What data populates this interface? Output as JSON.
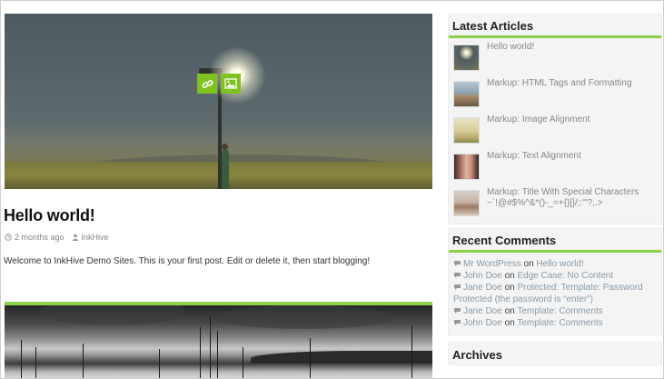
{
  "post": {
    "title": "Hello world!",
    "date": "2 months ago",
    "author": "InkHive",
    "excerpt": "Welcome to InkHive Demo Sites. This is your first post. Edit or delete it, then start blogging!"
  },
  "icons": {
    "link": "link-icon",
    "image": "image-icon",
    "clock": "clock-icon",
    "user": "user-icon",
    "comment": "comment-icon"
  },
  "colors": {
    "accent": "#8bd24a",
    "hover_button": "#7dc21e"
  },
  "sidebar": {
    "latest_title": "Latest Articles",
    "articles": [
      {
        "title": "Hello world!"
      },
      {
        "title": "Markup: HTML Tags and Formatting"
      },
      {
        "title": "Markup: Image Alignment"
      },
      {
        "title": "Markup: Text Alignment"
      },
      {
        "title": "Markup: Title With Special Characters ~`!@#$%^&*()-_=+{}[]/;:'\"?,.>"
      }
    ],
    "comments_title": "Recent Comments",
    "comments": [
      {
        "author": "Mr WordPress",
        "on": "on",
        "post": "Hello world!"
      },
      {
        "author": "John Doe",
        "on": "on",
        "post": "Edge Case: No Content"
      },
      {
        "author": "Jane Doe",
        "on": "on",
        "post": "Protected: Template: Password Protected (the password is “enter”)"
      },
      {
        "author": "Jane Doe",
        "on": "on",
        "post": "Template: Comments"
      },
      {
        "author": "John Doe",
        "on": "on",
        "post": "Template: Comments"
      }
    ],
    "archives_title": "Archives"
  }
}
